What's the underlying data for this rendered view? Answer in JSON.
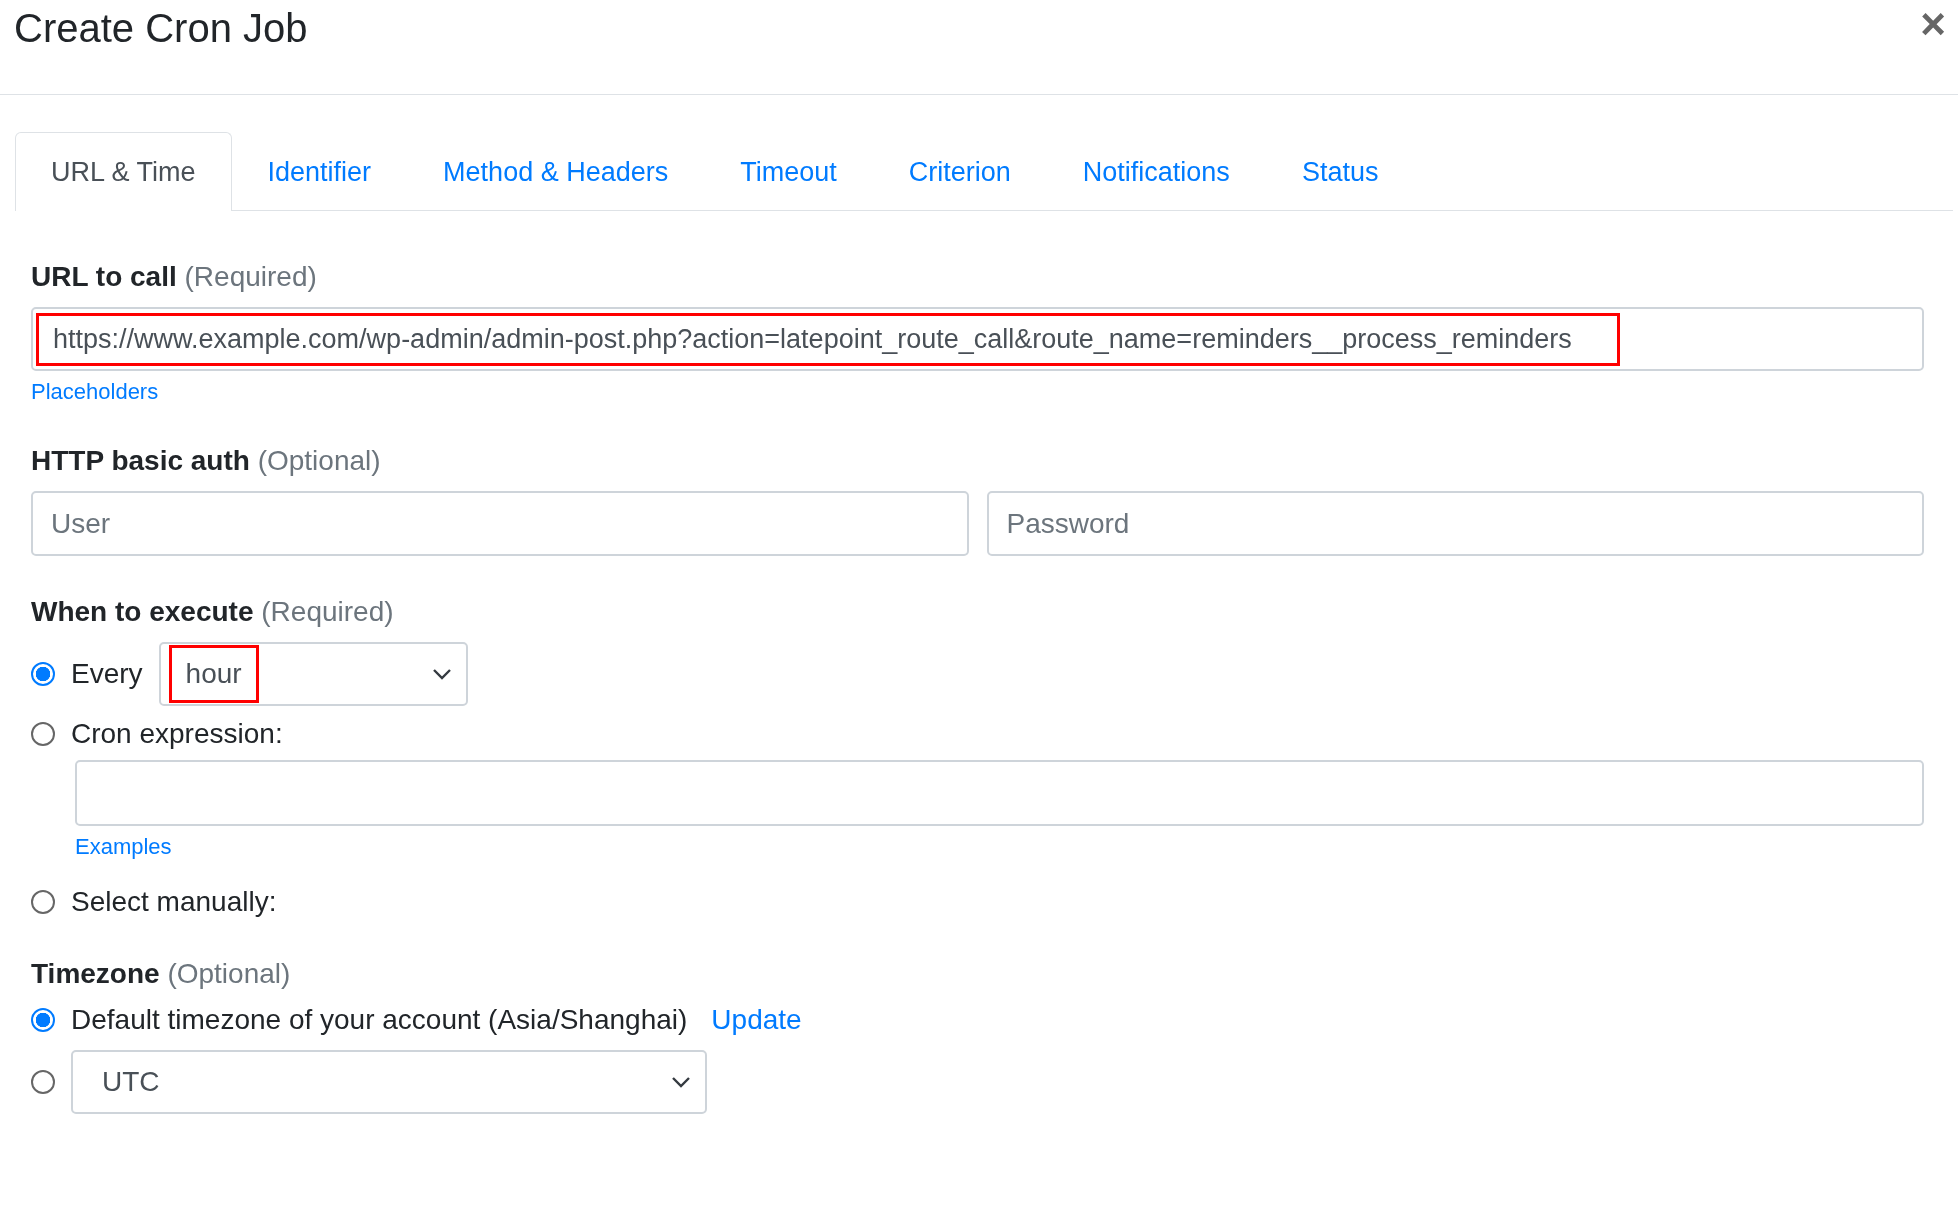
{
  "dialog": {
    "title": "Create Cron Job",
    "close": "×"
  },
  "tabs": [
    {
      "label": "URL & Time",
      "selected": true
    },
    {
      "label": "Identifier",
      "selected": false
    },
    {
      "label": "Method & Headers",
      "selected": false
    },
    {
      "label": "Timeout",
      "selected": false
    },
    {
      "label": "Criterion",
      "selected": false
    },
    {
      "label": "Notifications",
      "selected": false
    },
    {
      "label": "Status",
      "selected": false
    }
  ],
  "url_section": {
    "label": "URL to call",
    "hint": "(Required)",
    "value": "https://www.example.com/wp-admin/admin-post.php?action=latepoint_route_call&route_name=reminders__process_reminders",
    "highlighted": true,
    "link": "Placeholders"
  },
  "auth_section": {
    "label": "HTTP basic auth",
    "hint": "(Optional)",
    "user_placeholder": "User",
    "password_placeholder": "Password"
  },
  "schedule_section": {
    "label": "When to execute",
    "hint": "(Required)",
    "options": [
      {
        "kind": "every",
        "label": "Every",
        "selected": true,
        "value": "hour",
        "highlighted": true
      },
      {
        "kind": "cron",
        "label": "Cron expression:",
        "selected": false,
        "link": "Examples"
      },
      {
        "kind": "manual",
        "label": "Select manually:",
        "selected": false
      }
    ]
  },
  "timezone_section": {
    "label": "Timezone",
    "hint": "(Optional)",
    "options": [
      {
        "kind": "default",
        "label": "Default timezone of your account (Asia/Shanghai)",
        "link": "Update",
        "selected": true
      },
      {
        "kind": "select",
        "value": "UTC",
        "selected": false
      }
    ]
  }
}
